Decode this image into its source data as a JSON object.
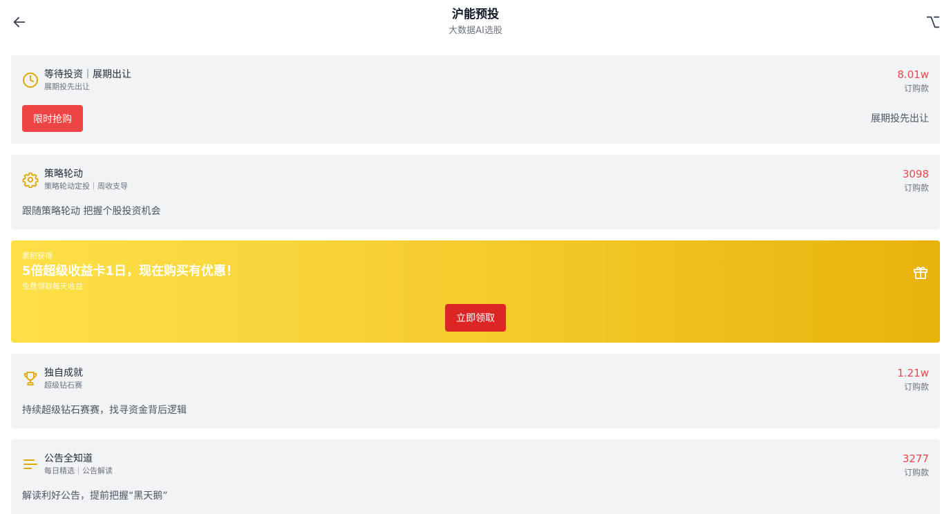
{
  "header": {
    "title": "沪能预投",
    "subtitle": "大数据AI选股"
  },
  "cards": [
    {
      "title": "等待投资｜展期出让",
      "subtitle": "展期投先出让",
      "value": "8.01w",
      "unit": "订购款",
      "button": "限时抢购",
      "right_text": "展期投先出让",
      "icon": "clock-icon"
    },
    {
      "title": "策略轮动",
      "subtitle": "策略轮动定投｜周收支导",
      "value": "3098",
      "unit": "订购款",
      "description": "跟随策略轮动 把握个股投资机会",
      "icon": "gear-icon"
    },
    {
      "title": "独自成就",
      "subtitle": "超级钻石赛",
      "value": "1.21w",
      "unit": "订购款",
      "description": "持续超级钻石赛赛，找寻资金背后逻辑",
      "icon": "trophy-icon"
    },
    {
      "title": "公告全知道",
      "subtitle": "每日精选｜公告解读",
      "value": "3277",
      "unit": "订购款",
      "description": "解读利好公告，提前把握“黑天鹅”",
      "icon": "list-icon"
    }
  ],
  "promo": {
    "kicker": "累积获得",
    "title": "5倍超级收益卡1日，现在购买有优惠！",
    "subtitle": "免费领取每天收益",
    "button": "立即领取",
    "icon": "gift-icon"
  },
  "colors": {
    "accent_red": "#ef4444",
    "value_red": "#e5484d",
    "icon_gold": "#e0a800",
    "card_bg": "#f2f3f5",
    "promo_start": "#fde047",
    "promo_end": "#e8b20c"
  }
}
